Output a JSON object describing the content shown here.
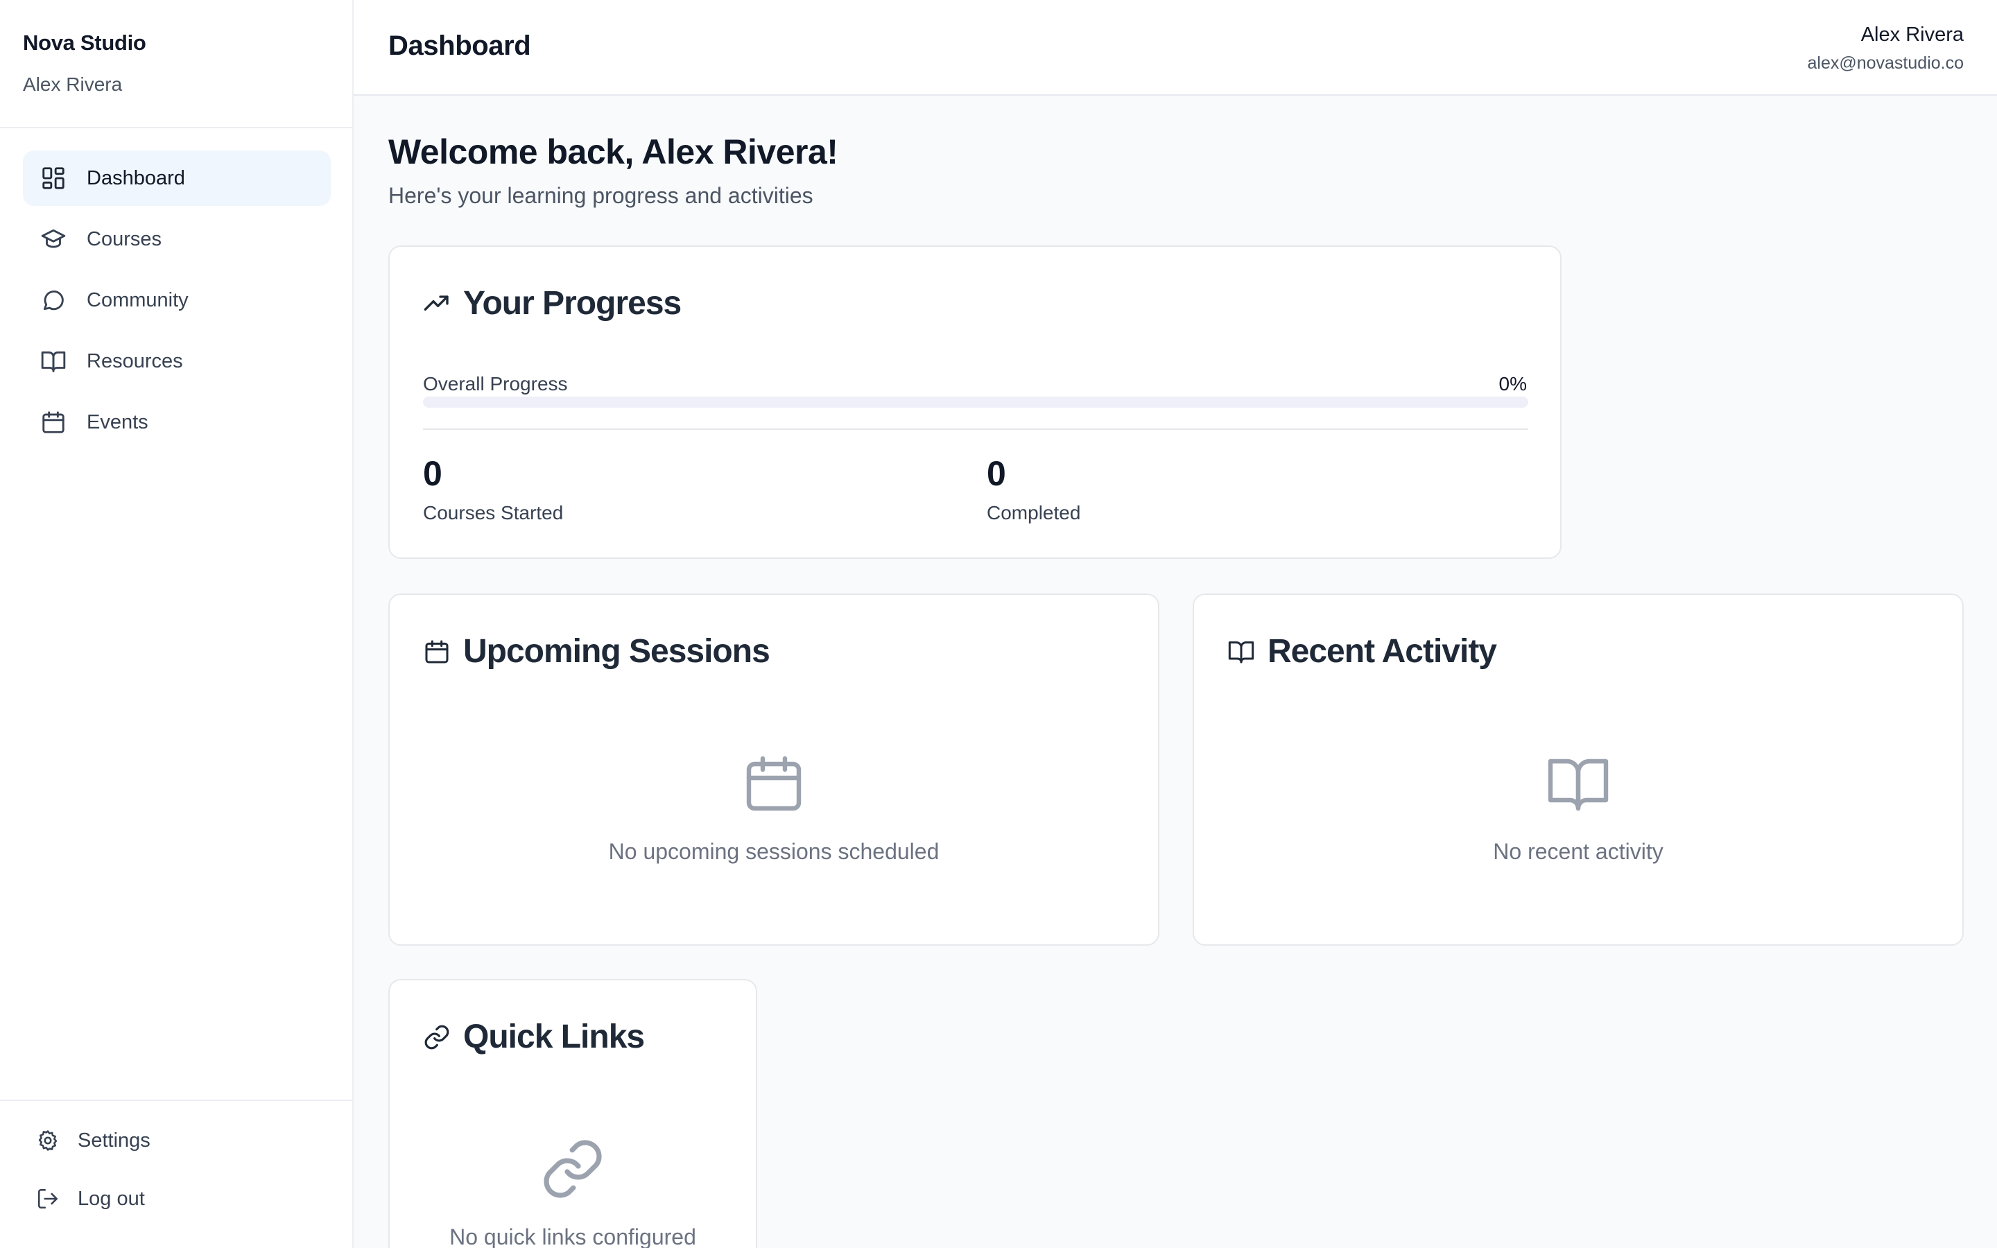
{
  "sidebar": {
    "brand": "Nova Studio",
    "user": "Alex Rivera",
    "nav": [
      {
        "label": "Dashboard",
        "icon": "dashboard-icon",
        "active": true
      },
      {
        "label": "Courses",
        "icon": "graduation-cap-icon"
      },
      {
        "label": "Community",
        "icon": "chat-bubble-icon"
      },
      {
        "label": "Resources",
        "icon": "book-open-icon"
      },
      {
        "label": "Events",
        "icon": "calendar-icon"
      }
    ],
    "bottom": [
      {
        "label": "Settings",
        "icon": "gear-icon"
      },
      {
        "label": "Log out",
        "icon": "logout-icon"
      }
    ]
  },
  "topbar": {
    "title": "Dashboard",
    "user_name": "Alex Rivera",
    "user_email": "alex@novastudio.co"
  },
  "main": {
    "welcome_title": "Welcome back, Alex Rivera!",
    "welcome_subtitle": "Here's your learning progress and activities",
    "progress": {
      "title": "Your Progress",
      "overall_label": "Overall Progress",
      "overall_value": "0%",
      "overall_fraction": 0,
      "courses_started_value": "0",
      "courses_started_label": "Courses Started",
      "completed_value": "0",
      "completed_label": "Completed"
    },
    "sessions": {
      "title": "Upcoming Sessions",
      "empty_message": "No upcoming sessions scheduled"
    },
    "activity": {
      "title": "Recent Activity",
      "empty_message": "No recent activity"
    },
    "quick_links": {
      "title": "Quick Links",
      "empty_message": "No quick links configured"
    }
  },
  "colors": {
    "accent": "#6366f1",
    "active_nav_bg": "#f0f6fe",
    "page_bg": "#f9fafc",
    "border": "#e6e8ec",
    "muted_icon": "#9ca3af"
  }
}
